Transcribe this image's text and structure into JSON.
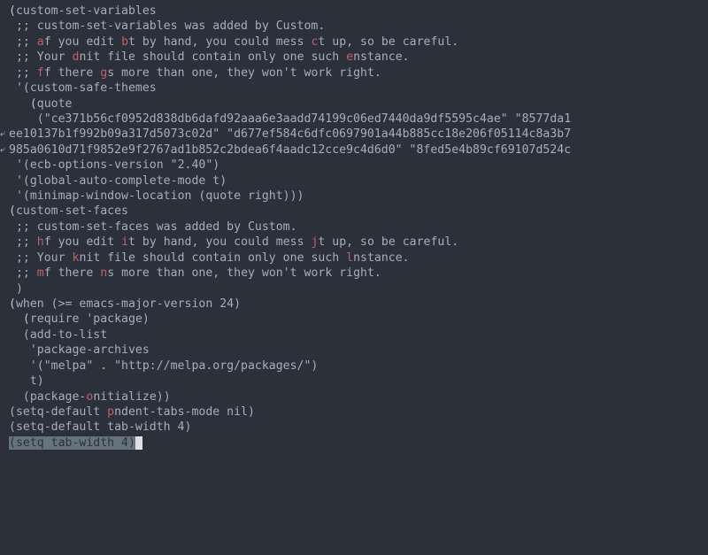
{
  "lines": [
    {
      "indent": "",
      "segments": [
        {
          "t": "(",
          "c": "kw"
        },
        {
          "t": "custom-set-variables",
          "c": "c"
        }
      ]
    },
    {
      "indent": " ",
      "segments": [
        {
          "t": ";; custom-set-variables was added by Custom.",
          "c": "c"
        }
      ]
    },
    {
      "indent": " ",
      "segments": [
        {
          "t": ";; ",
          "c": "c"
        },
        {
          "t": "a",
          "c": "hi"
        },
        {
          "t": "f you edit ",
          "c": "c"
        },
        {
          "t": "b",
          "c": "hi"
        },
        {
          "t": "t by hand, you could mess ",
          "c": "c"
        },
        {
          "t": "c",
          "c": "hi"
        },
        {
          "t": "t up, so be careful.",
          "c": "c"
        }
      ]
    },
    {
      "indent": " ",
      "segments": [
        {
          "t": ";; Your ",
          "c": "c"
        },
        {
          "t": "d",
          "c": "hi"
        },
        {
          "t": "nit file should contain only one such ",
          "c": "c"
        },
        {
          "t": "e",
          "c": "hi"
        },
        {
          "t": "nstance.",
          "c": "c"
        }
      ]
    },
    {
      "indent": " ",
      "segments": [
        {
          "t": ";; ",
          "c": "c"
        },
        {
          "t": "f",
          "c": "hi"
        },
        {
          "t": "f there ",
          "c": "c"
        },
        {
          "t": "g",
          "c": "hi"
        },
        {
          "t": "s more than one, they won't work right.",
          "c": "c"
        }
      ]
    },
    {
      "indent": " ",
      "segments": [
        {
          "t": "'(custom-safe-themes",
          "c": "c"
        }
      ]
    },
    {
      "indent": "   ",
      "segments": [
        {
          "t": "(",
          "c": "kw"
        },
        {
          "t": "quote",
          "c": "c"
        }
      ]
    },
    {
      "indent": "    ",
      "segments": [
        {
          "t": "(\"ce371b56cf0952d838db6dafd92aaa6e3aadd74199c06ed7440da9df5595c4ae\" \"8577da1",
          "c": "c"
        }
      ]
    },
    {
      "indent": "",
      "mark": true,
      "segments": [
        {
          "t": "ee10137b1f992b09a317d5073c02d\" \"d677ef584c6dfc0697901a44b885cc18e206f05114c8a3b7",
          "c": "c"
        }
      ]
    },
    {
      "indent": "",
      "mark": true,
      "segments": [
        {
          "t": "985a0610d71f9852e9f2767ad1b852c2bdea6f4aadc12cce9c4d6d0\" \"8fed5e4b89cf69107d524c",
          "c": "c"
        }
      ]
    },
    {
      "indent": " ",
      "segments": [
        {
          "t": "'(ecb-options-version \"2.40\")",
          "c": "c"
        }
      ]
    },
    {
      "indent": " ",
      "segments": [
        {
          "t": "'(global-auto-complete-mode t)",
          "c": "c"
        }
      ]
    },
    {
      "indent": " ",
      "segments": [
        {
          "t": "'(minimap-window-location (quote right)))",
          "c": "c"
        }
      ]
    },
    {
      "indent": "",
      "segments": [
        {
          "t": "(",
          "c": "kw"
        },
        {
          "t": "custom-set-faces",
          "c": "c"
        }
      ]
    },
    {
      "indent": " ",
      "segments": [
        {
          "t": ";; custom-set-faces was added by Custom.",
          "c": "c"
        }
      ]
    },
    {
      "indent": " ",
      "segments": [
        {
          "t": ";; ",
          "c": "c"
        },
        {
          "t": "h",
          "c": "hi"
        },
        {
          "t": "f you edit ",
          "c": "c"
        },
        {
          "t": "i",
          "c": "hi"
        },
        {
          "t": "t by hand, you could mess ",
          "c": "c"
        },
        {
          "t": "j",
          "c": "hi"
        },
        {
          "t": "t up, so be careful.",
          "c": "c"
        }
      ]
    },
    {
      "indent": " ",
      "segments": [
        {
          "t": ";; Your ",
          "c": "c"
        },
        {
          "t": "k",
          "c": "hi"
        },
        {
          "t": "nit file should contain only one such ",
          "c": "c"
        },
        {
          "t": "l",
          "c": "hi"
        },
        {
          "t": "nstance.",
          "c": "c"
        }
      ]
    },
    {
      "indent": " ",
      "segments": [
        {
          "t": ";; ",
          "c": "c"
        },
        {
          "t": "m",
          "c": "hi"
        },
        {
          "t": "f there ",
          "c": "c"
        },
        {
          "t": "n",
          "c": "hi"
        },
        {
          "t": "s more than one, they won't work right.",
          "c": "c"
        }
      ]
    },
    {
      "indent": " ",
      "segments": [
        {
          "t": ")",
          "c": "c"
        }
      ]
    },
    {
      "indent": "",
      "segments": [
        {
          "t": "",
          "c": "c"
        }
      ]
    },
    {
      "indent": "",
      "segments": [
        {
          "t": "(",
          "c": "kw"
        },
        {
          "t": "when",
          "c": "c"
        },
        {
          "t": " (>= emacs-major-version 24)",
          "c": "c"
        }
      ]
    },
    {
      "indent": "  ",
      "segments": [
        {
          "t": "(",
          "c": "kw"
        },
        {
          "t": "require",
          "c": "c"
        },
        {
          "t": " 'package)",
          "c": "c"
        }
      ]
    },
    {
      "indent": "  ",
      "segments": [
        {
          "t": "(add-to-list",
          "c": "c"
        }
      ]
    },
    {
      "indent": "   ",
      "segments": [
        {
          "t": "'package-archives",
          "c": "c"
        }
      ]
    },
    {
      "indent": "   ",
      "segments": [
        {
          "t": "'(\"melpa\" . \"http://melpa.org/packages/\")",
          "c": "c"
        }
      ]
    },
    {
      "indent": "   ",
      "segments": [
        {
          "t": "t)",
          "c": "c"
        }
      ]
    },
    {
      "indent": "  ",
      "segments": [
        {
          "t": "(package-",
          "c": "c"
        },
        {
          "t": "o",
          "c": "hi"
        },
        {
          "t": "nitialize))",
          "c": "c"
        }
      ]
    },
    {
      "indent": "",
      "segments": [
        {
          "t": "",
          "c": "c"
        }
      ]
    },
    {
      "indent": "",
      "segments": [
        {
          "t": "(setq-default ",
          "c": "c"
        },
        {
          "t": "p",
          "c": "hi"
        },
        {
          "t": "ndent-tabs-mode nil)",
          "c": "c"
        }
      ]
    },
    {
      "indent": "",
      "segments": [
        {
          "t": "(setq-default tab-width 4)",
          "c": "c"
        }
      ]
    }
  ],
  "current_line": {
    "leading_paren_open": "(",
    "body": "setq tab-width 4",
    "trailing_paren_close": ")"
  }
}
